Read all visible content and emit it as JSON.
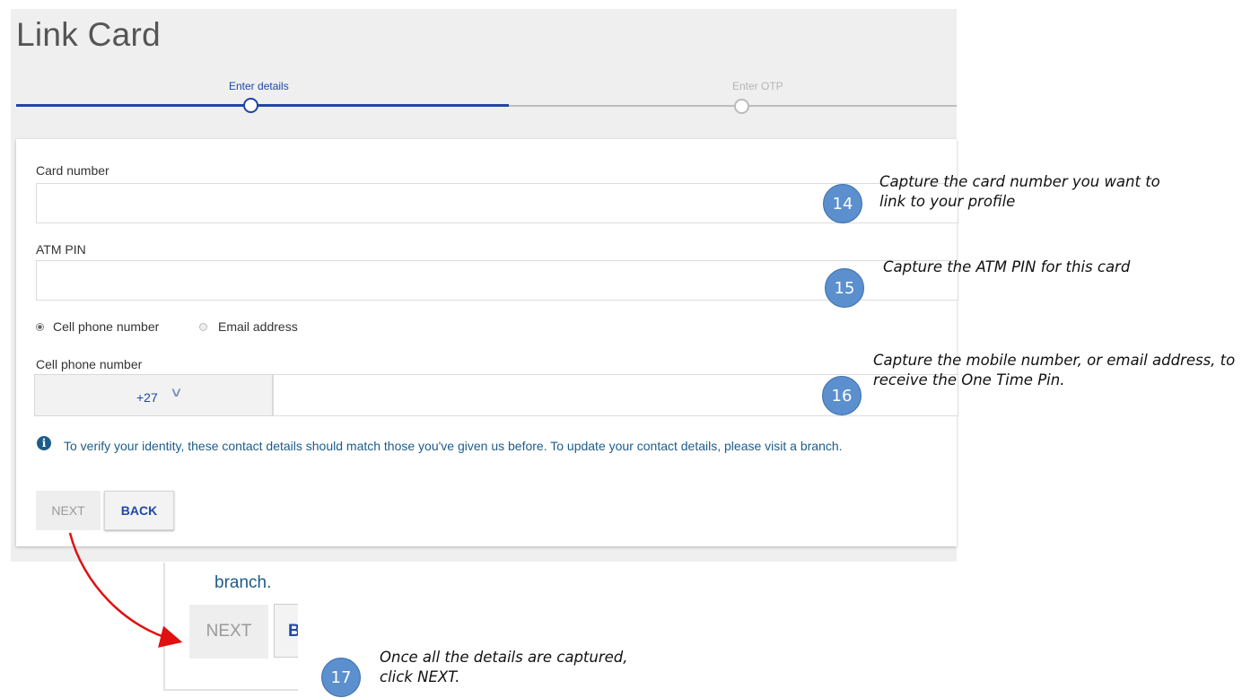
{
  "page": {
    "title": "Link Card"
  },
  "stepper": {
    "steps": [
      {
        "label": "Enter details",
        "state": "active"
      },
      {
        "label": "Enter OTP",
        "state": "inactive"
      }
    ]
  },
  "form": {
    "card_number_label": "Card number",
    "card_number_value": "",
    "atm_pin_label": "ATM PIN",
    "atm_pin_value": "",
    "contact_options": [
      {
        "label": "Cell phone number",
        "selected": true
      },
      {
        "label": "Email address",
        "selected": false
      }
    ],
    "cell_phone_label": "Cell phone number",
    "country_code": "+27",
    "cell_phone_value": "",
    "info_text": "To verify your identity, these contact details should match those you've given us before. To update your contact details, please visit a branch.",
    "next_label": "NEXT",
    "back_label": "BACK"
  },
  "zoom_inset": {
    "text": "branch.",
    "next_label": "NEXT",
    "back_label": "BA"
  },
  "annotations": [
    {
      "number": "14",
      "text": "Capture the card number you want to link to your profile"
    },
    {
      "number": "15",
      "text": "Capture the ATM PIN for this card"
    },
    {
      "number": "16",
      "text": "Capture the mobile number, or email address, to receive the One Time Pin."
    },
    {
      "number": "17",
      "text": "Once all the details are captured, click NEXT."
    }
  ],
  "colors": {
    "primary_blue": "#1f45a6",
    "info_blue": "#1d5c8a",
    "badge_blue": "#5b8fce",
    "arrow_red": "#e01010"
  },
  "icons": {
    "info": "info-circle-icon",
    "chevron": "chevron-down-icon"
  }
}
